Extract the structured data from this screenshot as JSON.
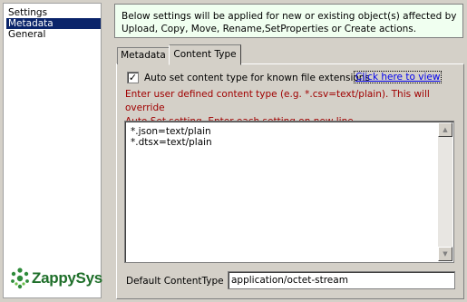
{
  "nav": {
    "items": [
      {
        "label": "Settings"
      },
      {
        "label": "Metadata"
      },
      {
        "label": "General"
      }
    ],
    "logo_text": "ZappySys"
  },
  "info": {
    "line1": "Below settings will be applied for new or existing object(s) affected by",
    "line2": "Upload, Copy, Move, Rename,SetProperties or Create actions."
  },
  "tabs": [
    {
      "label": "Metadata"
    },
    {
      "label": "Content Type"
    }
  ],
  "content_type": {
    "auto_set_label": "Auto set content type for known file extensions",
    "auto_set_checked": true,
    "link_text": "Click here to view",
    "hint_line1": "Enter user defined content type (e.g. *.csv=text/plain). This will override",
    "hint_line2": "Auto Set setting. Enter each setting on new line.",
    "lines": [
      "*.json=text/plain",
      "*.dtsx=text/plain"
    ],
    "default_label": "Default ContentType",
    "default_value": "application/octet-stream"
  },
  "colors": {
    "selection": "#0a246a",
    "hint": "#a00000",
    "info_bg": "#f0fff0",
    "logo": "#1f6f2a"
  }
}
